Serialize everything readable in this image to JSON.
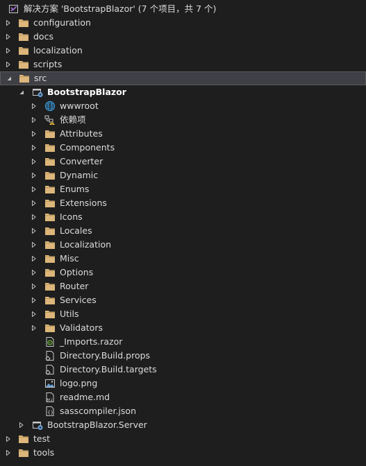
{
  "solution": {
    "label": "解决方案 'BootstrapBlazor' (7 个项目，共 7 个)"
  },
  "root_folders": {
    "configuration": "configuration",
    "docs": "docs",
    "localization": "localization",
    "scripts": "scripts",
    "src": "src",
    "test": "test",
    "tools": "tools"
  },
  "project": {
    "label": "BootstrapBlazor",
    "items": {
      "wwwroot": "wwwroot",
      "dependencies": "依赖项",
      "attributes": "Attributes",
      "components": "Components",
      "converter": "Converter",
      "dynamic": "Dynamic",
      "enums": "Enums",
      "extensions": "Extensions",
      "icons": "Icons",
      "locales": "Locales",
      "localization": "Localization",
      "misc": "Misc",
      "options": "Options",
      "router": "Router",
      "services": "Services",
      "utils": "Utils",
      "validators": "Validators",
      "imports_razor": "_Imports.razor",
      "directory_build_props": "Directory.Build.props",
      "directory_build_targets": "Directory.Build.targets",
      "logo_png": "logo.png",
      "readme_md": "readme.md",
      "sasscompiler_json": "sasscompiler.json"
    }
  },
  "server_project": {
    "label": "BootstrapBlazor.Server"
  },
  "colors": {
    "background": "#1e1e1e",
    "selection": "#3f3f46",
    "folder": "#dcb67a",
    "project_accent": "#68a0d8",
    "web_globe": "#3b9bdc",
    "text": "#dcdcdc"
  }
}
